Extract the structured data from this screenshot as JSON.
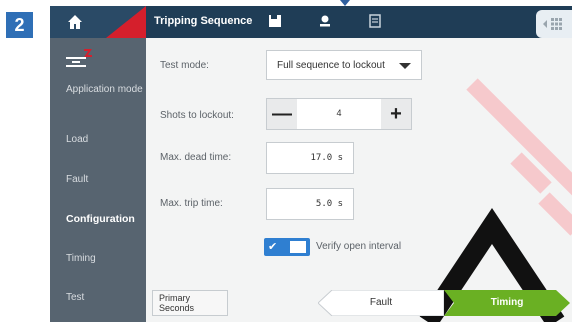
{
  "step_number": "2",
  "header": {
    "title": "Tripping Sequence",
    "icons": [
      "home-icon",
      "save-icon",
      "user-icon",
      "print-icon",
      "grid-icon"
    ]
  },
  "sidebar": {
    "icon": "application-mode-icon",
    "items": [
      {
        "label": "Application mode",
        "active": false
      },
      {
        "label": "Load",
        "active": false
      },
      {
        "label": "Fault",
        "active": false
      },
      {
        "label": "Configuration",
        "active": true
      },
      {
        "label": "Timing",
        "active": false
      },
      {
        "label": "Test",
        "active": false
      }
    ]
  },
  "form": {
    "test_mode": {
      "label": "Test mode:",
      "value": "Full sequence to lockout"
    },
    "shots_to_lockout": {
      "label": "Shots to lockout:",
      "value": "4",
      "minus": "—",
      "plus": "+"
    },
    "max_dead_time": {
      "label": "Max. dead time:",
      "value": "17.0 s"
    },
    "max_trip_time": {
      "label": "Max. trip time:",
      "value": "5.0 s"
    },
    "verify_open_interval": {
      "label": "Verify open interval",
      "checked": true
    }
  },
  "footer": {
    "units_button": "Primary\nSeconds",
    "back_button": "Fault",
    "next_button": "Timing"
  },
  "colors": {
    "step_badge": "#2f6fb6",
    "accent_red": "#d51f2c",
    "toggle_blue": "#2f7fd1",
    "next_green": "#6ab023"
  }
}
